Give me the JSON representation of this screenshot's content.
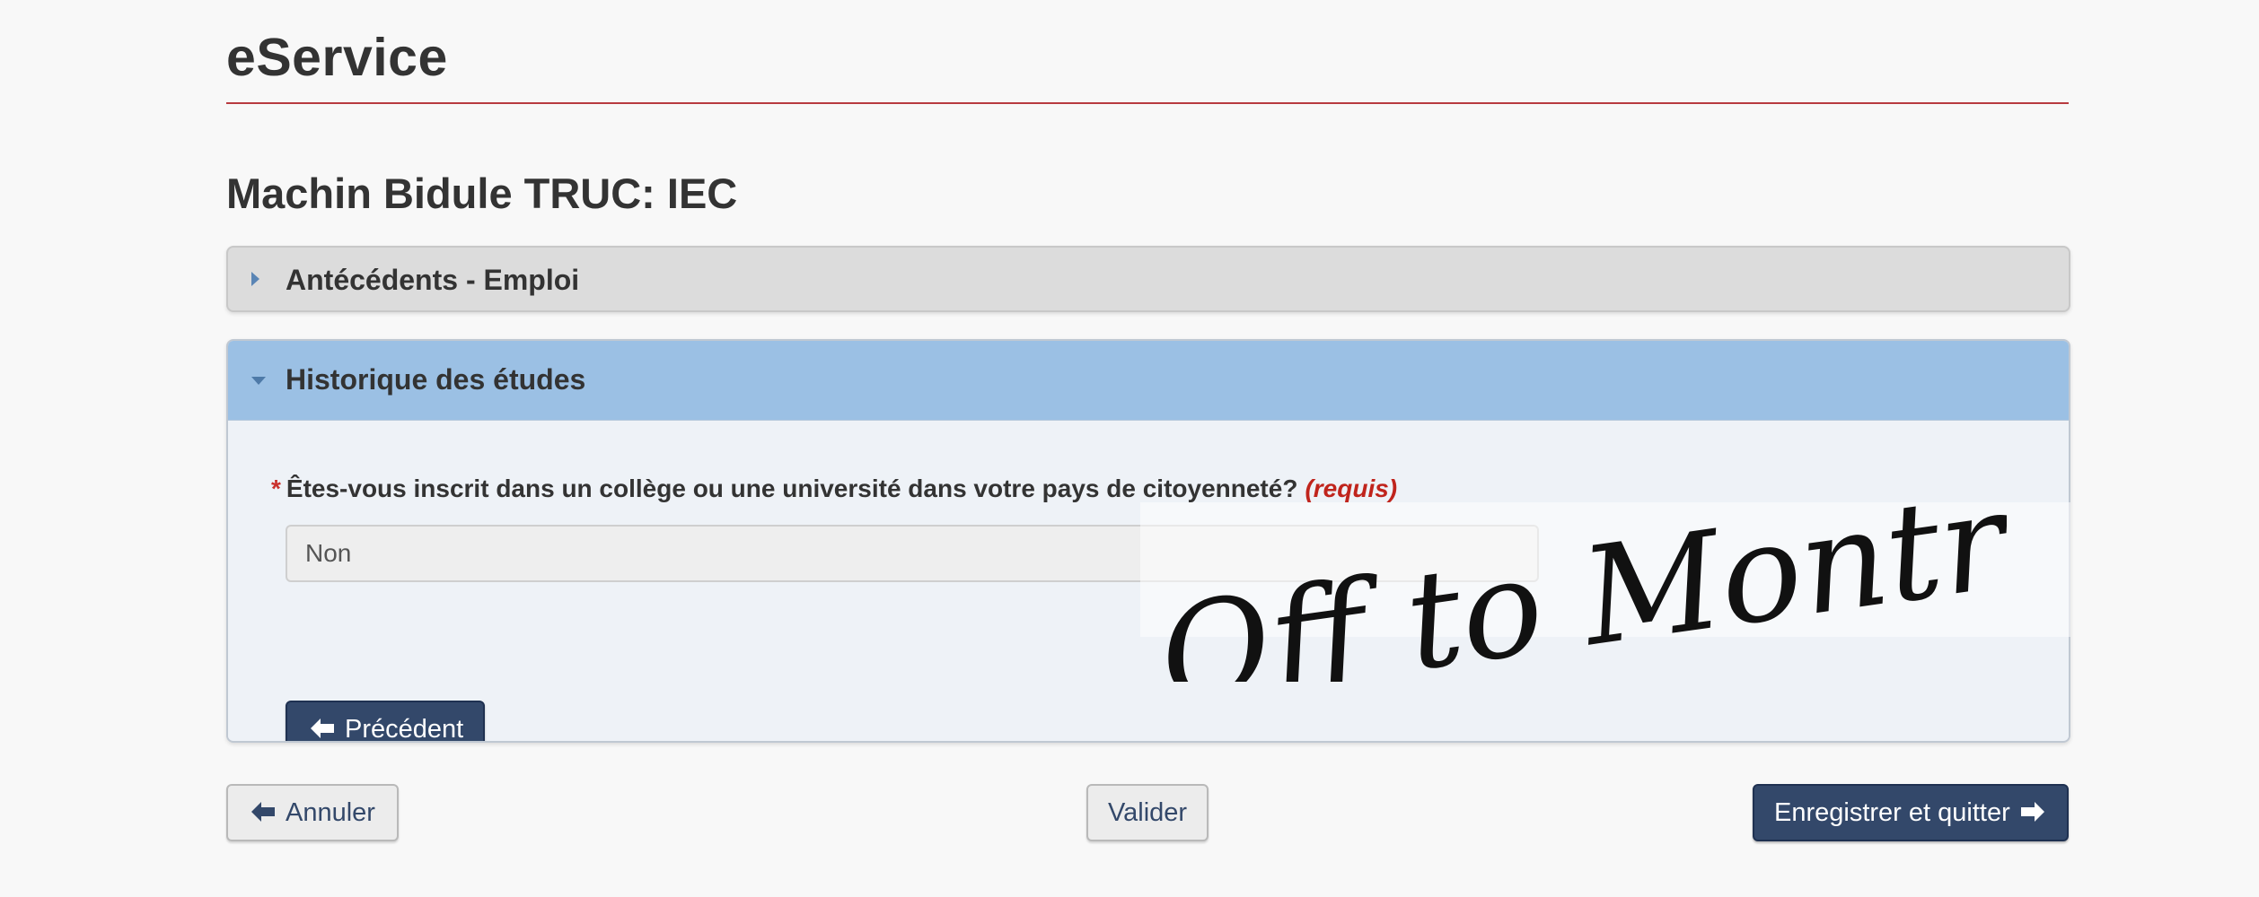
{
  "header": {
    "app_title": "eService"
  },
  "page": {
    "title": "Machin Bidule TRUC: IEC"
  },
  "panels": [
    {
      "title": "Antécédents - Emploi",
      "expanded": false
    },
    {
      "title": "Historique des études",
      "expanded": true,
      "question": {
        "required_marker": "*",
        "label": "Êtes-vous inscrit dans un collège ou une université dans votre pays de citoyenneté?",
        "required_text": "(requis)",
        "value": "Non"
      },
      "previous_button": "Précédent"
    }
  ],
  "footer": {
    "cancel_label": "Annuler",
    "validate_label": "Valider",
    "save_quit_label": "Enregistrer et quitter"
  },
  "overlay": {
    "handwriting": "Off to Montréal"
  },
  "colors": {
    "header_rule": "#b83a3f",
    "primary_button": "#33486a",
    "expanded_panel_heading": "#9bc0e4",
    "collapsed_panel_heading": "#dcdcdc",
    "required": "#c0241c"
  },
  "icons": {
    "collapsed_caret": "caret-right-icon",
    "expanded_caret": "caret-down-icon",
    "previous": "arrow-left-icon",
    "cancel": "arrow-left-icon",
    "save_quit": "arrow-right-icon"
  }
}
